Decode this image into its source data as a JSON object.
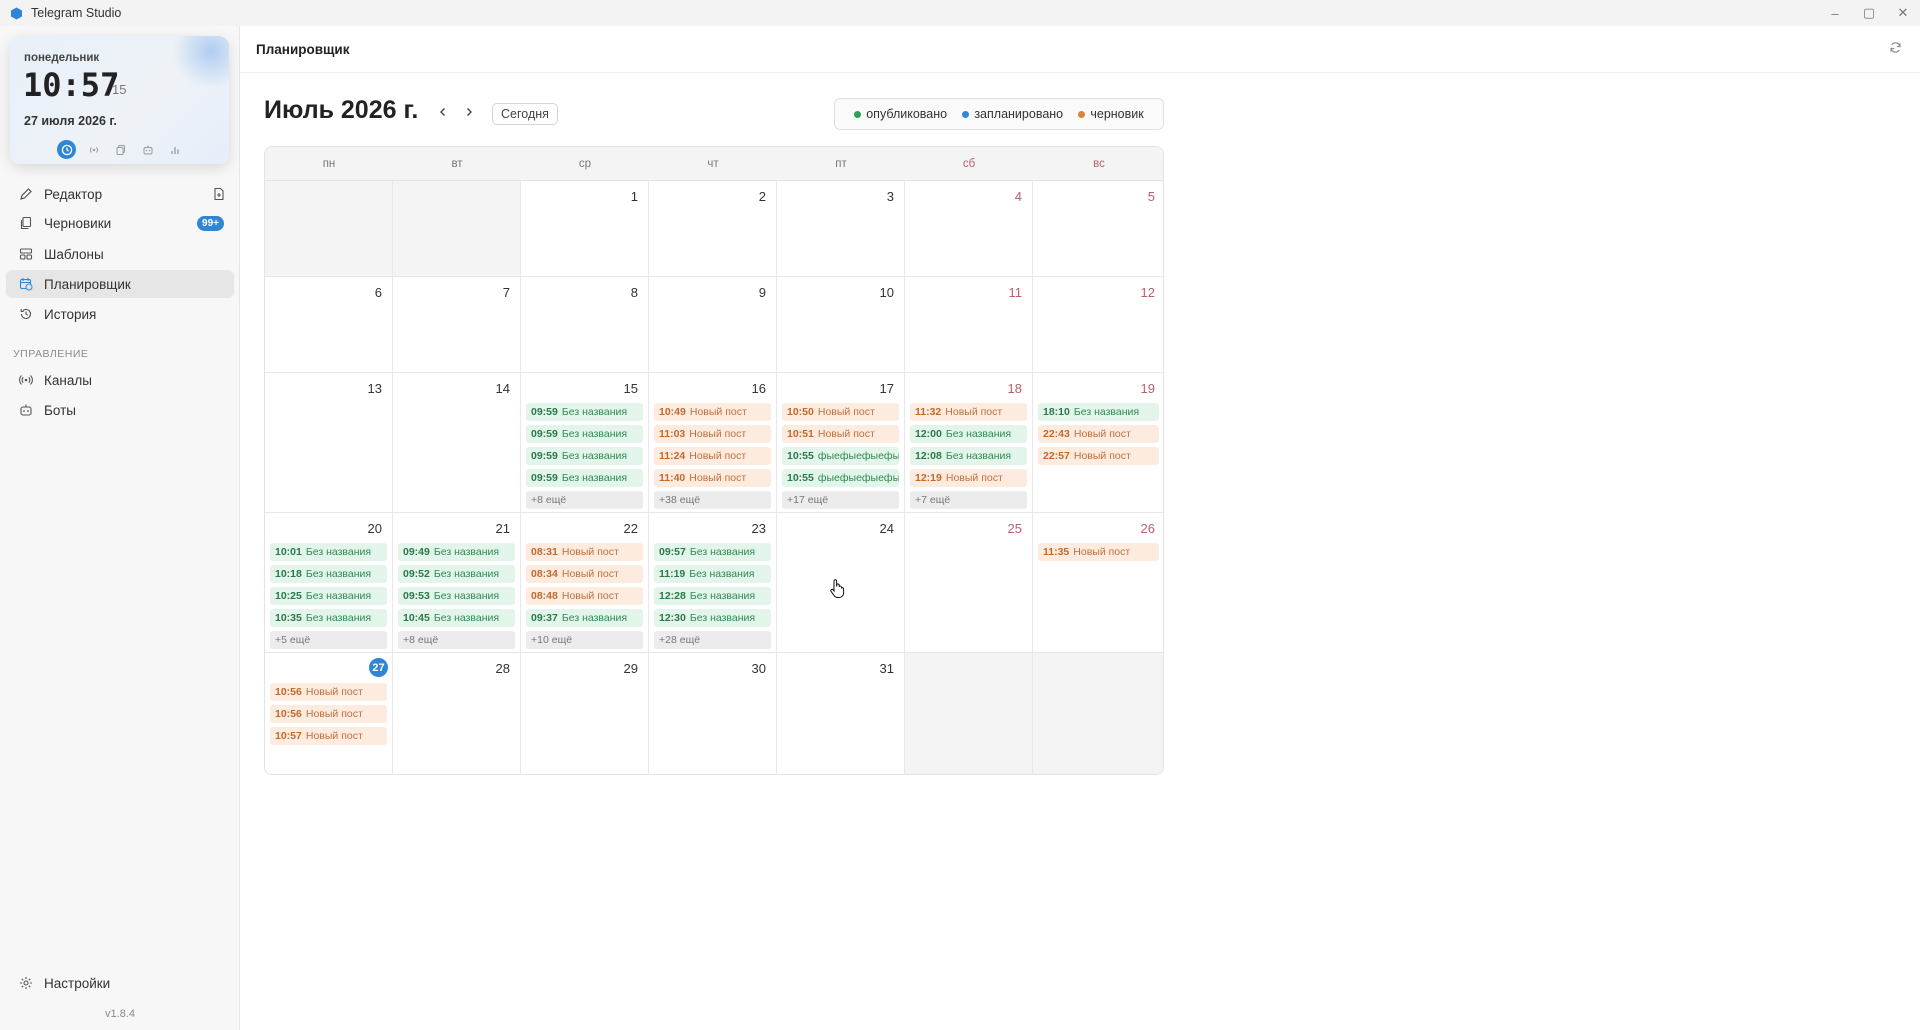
{
  "window": {
    "title": "Telegram Studio",
    "controls": [
      "–",
      "▢",
      "✕"
    ]
  },
  "clock": {
    "weekday": "понедельник",
    "time": "10:57",
    "seconds": "15",
    "date": "27 июля 2026 г."
  },
  "nav": {
    "editor": "Редактор",
    "drafts": "Черновики",
    "drafts_badge": "99+",
    "templates": "Шаблоны",
    "planner": "Планировщик",
    "history": "История",
    "section": "УПРАВЛЕНИЕ",
    "channels": "Каналы",
    "bots": "Боты",
    "settings": "Настройки",
    "version": "v1.8.4"
  },
  "header": {
    "title": "Планировщик"
  },
  "calendar": {
    "month_title": "Июль 2026 г.",
    "today_button": "Сегодня",
    "legend": {
      "published": "опубликовано",
      "scheduled": "запланировано",
      "draft": "черновик"
    },
    "weekdays": [
      "пн",
      "вт",
      "ср",
      "чт",
      "пт",
      "сб",
      "вс"
    ],
    "weeks": [
      [
        null,
        null,
        {
          "day": "1"
        },
        {
          "day": "2"
        },
        {
          "day": "3"
        },
        {
          "day": "4"
        },
        {
          "day": "5"
        }
      ],
      [
        {
          "day": "6"
        },
        {
          "day": "7"
        },
        {
          "day": "8"
        },
        {
          "day": "9"
        },
        {
          "day": "10"
        },
        {
          "day": "11"
        },
        {
          "day": "12"
        }
      ],
      [
        {
          "day": "13"
        },
        {
          "day": "14"
        },
        {
          "day": "15",
          "events": [
            {
              "time": "09:59",
              "title": "Без названия",
              "status": "pub"
            },
            {
              "time": "09:59",
              "title": "Без названия",
              "status": "pub"
            },
            {
              "time": "09:59",
              "title": "Без названия",
              "status": "pub"
            },
            {
              "time": "09:59",
              "title": "Без названия",
              "status": "pub"
            }
          ],
          "more": "+8 ещё"
        },
        {
          "day": "16",
          "events": [
            {
              "time": "10:49",
              "title": "Новый пост",
              "status": "draft"
            },
            {
              "time": "11:03",
              "title": "Новый пост",
              "status": "draft"
            },
            {
              "time": "11:24",
              "title": "Новый пост",
              "status": "draft"
            },
            {
              "time": "11:40",
              "title": "Новый пост",
              "status": "draft"
            }
          ],
          "more": "+38 ещё"
        },
        {
          "day": "17",
          "events": [
            {
              "time": "10:50",
              "title": "Новый пост",
              "status": "draft"
            },
            {
              "time": "10:51",
              "title": "Новый пост",
              "status": "draft"
            },
            {
              "time": "10:55",
              "title": "фыефыефыефыв",
              "status": "pub"
            },
            {
              "time": "10:55",
              "title": "фыефыефыефыв",
              "status": "pub"
            }
          ],
          "more": "+17 ещё"
        },
        {
          "day": "18",
          "events": [
            {
              "time": "11:32",
              "title": "Новый пост",
              "status": "draft"
            },
            {
              "time": "12:00",
              "title": "Без названия",
              "status": "pub"
            },
            {
              "time": "12:08",
              "title": "Без названия",
              "status": "pub"
            },
            {
              "time": "12:19",
              "title": "Новый пост",
              "status": "draft"
            }
          ],
          "more": "+7 ещё"
        },
        {
          "day": "19",
          "events": [
            {
              "time": "18:10",
              "title": "Без названия",
              "status": "pub"
            },
            {
              "time": "22:43",
              "title": "Новый пост",
              "status": "draft"
            },
            {
              "time": "22:57",
              "title": "Новый пост",
              "status": "draft"
            }
          ]
        }
      ],
      [
        {
          "day": "20",
          "events": [
            {
              "time": "10:01",
              "title": "Без названия",
              "status": "pub"
            },
            {
              "time": "10:18",
              "title": "Без названия",
              "status": "pub"
            },
            {
              "time": "10:25",
              "title": "Без названия",
              "status": "pub"
            },
            {
              "time": "10:35",
              "title": "Без названия",
              "status": "pub"
            }
          ],
          "more": "+5 ещё"
        },
        {
          "day": "21",
          "events": [
            {
              "time": "09:49",
              "title": "Без названия",
              "status": "pub"
            },
            {
              "time": "09:52",
              "title": "Без названия",
              "status": "pub"
            },
            {
              "time": "09:53",
              "title": "Без названия",
              "status": "pub"
            },
            {
              "time": "10:45",
              "title": "Без названия",
              "status": "pub"
            }
          ],
          "more": "+8 ещё"
        },
        {
          "day": "22",
          "events": [
            {
              "time": "08:31",
              "title": "Новый пост",
              "status": "draft"
            },
            {
              "time": "08:34",
              "title": "Новый пост",
              "status": "draft"
            },
            {
              "time": "08:48",
              "title": "Новый пост",
              "status": "draft"
            },
            {
              "time": "09:37",
              "title": "Без названия",
              "status": "pub"
            }
          ],
          "more": "+10 ещё"
        },
        {
          "day": "23",
          "events": [
            {
              "time": "09:57",
              "title": "Без названия",
              "status": "pub"
            },
            {
              "time": "11:19",
              "title": "Без названия",
              "status": "pub"
            },
            {
              "time": "12:28",
              "title": "Без названия",
              "status": "pub"
            },
            {
              "time": "12:30",
              "title": "Без названия",
              "status": "pub"
            }
          ],
          "more": "+28 ещё"
        },
        {
          "day": "24"
        },
        {
          "day": "25"
        },
        {
          "day": "26",
          "events": [
            {
              "time": "11:35",
              "title": "Новый пост",
              "status": "draft"
            }
          ]
        }
      ],
      [
        {
          "day": "27",
          "today": true,
          "events": [
            {
              "time": "10:56",
              "title": "Новый пост",
              "status": "draft"
            },
            {
              "time": "10:56",
              "title": "Новый пост",
              "status": "draft"
            },
            {
              "time": "10:57",
              "title": "Новый пост",
              "status": "draft"
            }
          ]
        },
        {
          "day": "28"
        },
        {
          "day": "29"
        },
        {
          "day": "30"
        },
        {
          "day": "31"
        },
        null,
        null
      ]
    ]
  },
  "colors": {
    "accent": "#2f86d6",
    "published": "#2e9e5a",
    "scheduled": "#2f86d6",
    "draft": "#d9843d",
    "weekend": "#b8606a"
  }
}
